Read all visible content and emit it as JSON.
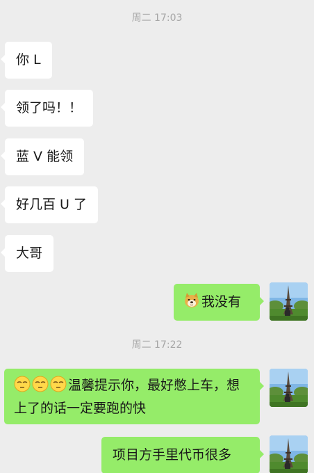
{
  "timestamps": [
    "周二 17:03",
    "周二 17:22"
  ],
  "messages": [
    {
      "side": "in",
      "text": "你 L"
    },
    {
      "side": "in",
      "text": "领了吗！！"
    },
    {
      "side": "in",
      "text": "蓝 V 能领"
    },
    {
      "side": "in",
      "text": "好几百 U 了"
    },
    {
      "side": "in",
      "text": "大哥"
    },
    {
      "side": "out",
      "emoji": [
        "doge-face"
      ],
      "text": "我没有"
    },
    {
      "side": "out",
      "emoji": [
        "relieved-face",
        "relieved-face",
        "relieved-face"
      ],
      "text": "温馨提示你，最好憋上车，想上了的话一定要跑的快"
    },
    {
      "side": "out",
      "text": "项目方手里代币很多"
    }
  ],
  "colors": {
    "background": "#ededed",
    "incoming_bubble": "#ffffff",
    "outgoing_bubble": "#95ec69",
    "timestamp": "#a6a6a6"
  },
  "avatar_icon": "eiffel-tower-photo-avatar"
}
